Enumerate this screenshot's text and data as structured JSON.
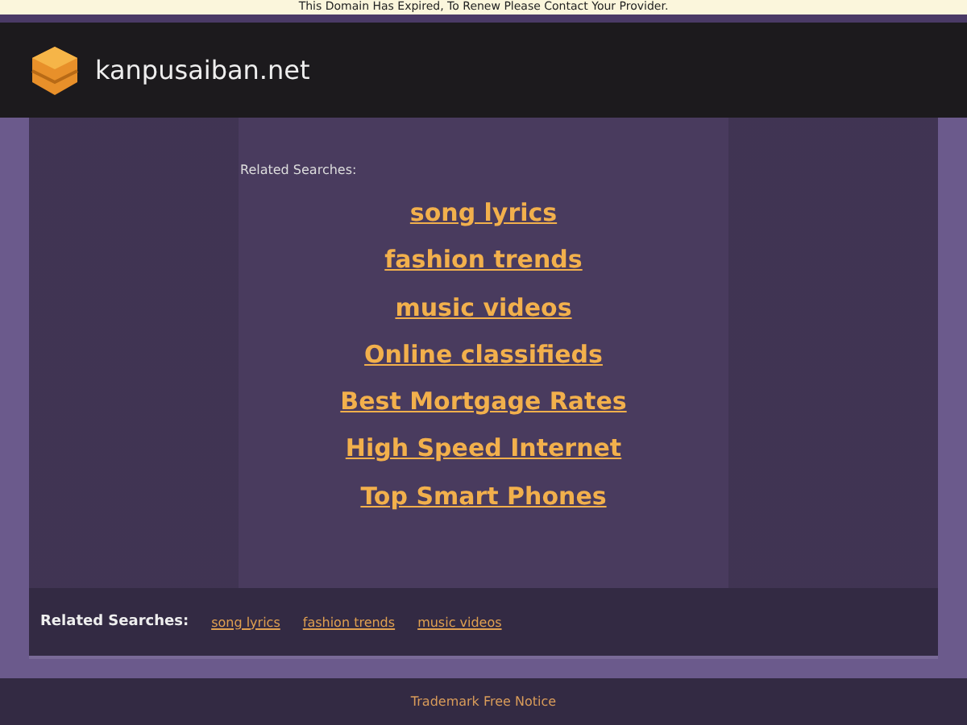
{
  "notice_bar": {
    "text": "This Domain Has Expired, To Renew Please Contact Your Provider."
  },
  "header": {
    "site_name": "kanpusaiban.net"
  },
  "main": {
    "heading": "Related Searches:",
    "links": [
      "song lyrics",
      "fashion trends",
      "music videos",
      "Online classifieds",
      "Best Mortgage Rates",
      "High Speed Internet",
      "Top Smart Phones"
    ]
  },
  "bottom_bar": {
    "label": "Related Searches:",
    "links": [
      "song lyrics",
      "fashion trends",
      "music videos"
    ]
  },
  "footer": {
    "link": "Trademark Free Notice"
  }
}
